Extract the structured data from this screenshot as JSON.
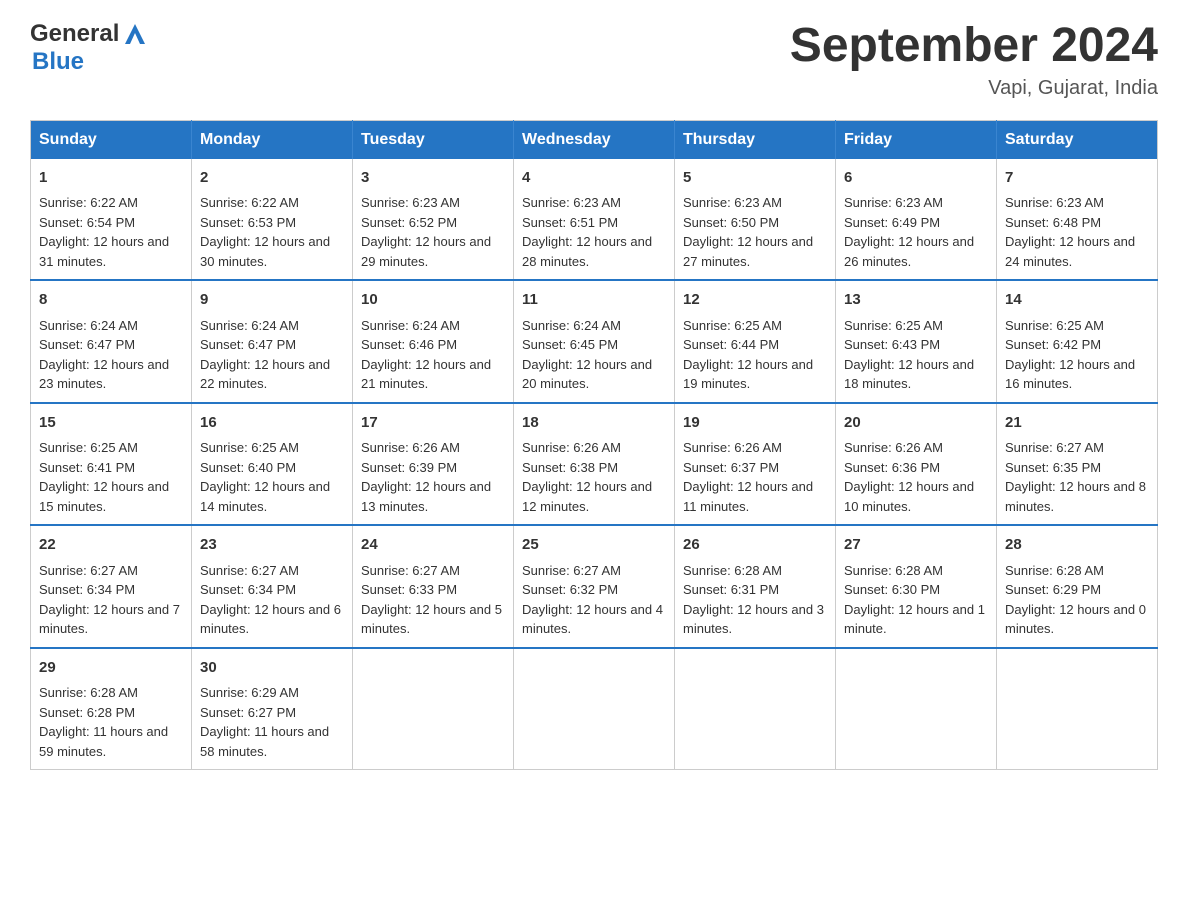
{
  "header": {
    "logo_general": "General",
    "logo_blue": "Blue",
    "title": "September 2024",
    "location": "Vapi, Gujarat, India"
  },
  "days_of_week": [
    "Sunday",
    "Monday",
    "Tuesday",
    "Wednesday",
    "Thursday",
    "Friday",
    "Saturday"
  ],
  "weeks": [
    [
      {
        "day": "1",
        "sunrise": "Sunrise: 6:22 AM",
        "sunset": "Sunset: 6:54 PM",
        "daylight": "Daylight: 12 hours and 31 minutes."
      },
      {
        "day": "2",
        "sunrise": "Sunrise: 6:22 AM",
        "sunset": "Sunset: 6:53 PM",
        "daylight": "Daylight: 12 hours and 30 minutes."
      },
      {
        "day": "3",
        "sunrise": "Sunrise: 6:23 AM",
        "sunset": "Sunset: 6:52 PM",
        "daylight": "Daylight: 12 hours and 29 minutes."
      },
      {
        "day": "4",
        "sunrise": "Sunrise: 6:23 AM",
        "sunset": "Sunset: 6:51 PM",
        "daylight": "Daylight: 12 hours and 28 minutes."
      },
      {
        "day": "5",
        "sunrise": "Sunrise: 6:23 AM",
        "sunset": "Sunset: 6:50 PM",
        "daylight": "Daylight: 12 hours and 27 minutes."
      },
      {
        "day": "6",
        "sunrise": "Sunrise: 6:23 AM",
        "sunset": "Sunset: 6:49 PM",
        "daylight": "Daylight: 12 hours and 26 minutes."
      },
      {
        "day": "7",
        "sunrise": "Sunrise: 6:23 AM",
        "sunset": "Sunset: 6:48 PM",
        "daylight": "Daylight: 12 hours and 24 minutes."
      }
    ],
    [
      {
        "day": "8",
        "sunrise": "Sunrise: 6:24 AM",
        "sunset": "Sunset: 6:47 PM",
        "daylight": "Daylight: 12 hours and 23 minutes."
      },
      {
        "day": "9",
        "sunrise": "Sunrise: 6:24 AM",
        "sunset": "Sunset: 6:47 PM",
        "daylight": "Daylight: 12 hours and 22 minutes."
      },
      {
        "day": "10",
        "sunrise": "Sunrise: 6:24 AM",
        "sunset": "Sunset: 6:46 PM",
        "daylight": "Daylight: 12 hours and 21 minutes."
      },
      {
        "day": "11",
        "sunrise": "Sunrise: 6:24 AM",
        "sunset": "Sunset: 6:45 PM",
        "daylight": "Daylight: 12 hours and 20 minutes."
      },
      {
        "day": "12",
        "sunrise": "Sunrise: 6:25 AM",
        "sunset": "Sunset: 6:44 PM",
        "daylight": "Daylight: 12 hours and 19 minutes."
      },
      {
        "day": "13",
        "sunrise": "Sunrise: 6:25 AM",
        "sunset": "Sunset: 6:43 PM",
        "daylight": "Daylight: 12 hours and 18 minutes."
      },
      {
        "day": "14",
        "sunrise": "Sunrise: 6:25 AM",
        "sunset": "Sunset: 6:42 PM",
        "daylight": "Daylight: 12 hours and 16 minutes."
      }
    ],
    [
      {
        "day": "15",
        "sunrise": "Sunrise: 6:25 AM",
        "sunset": "Sunset: 6:41 PM",
        "daylight": "Daylight: 12 hours and 15 minutes."
      },
      {
        "day": "16",
        "sunrise": "Sunrise: 6:25 AM",
        "sunset": "Sunset: 6:40 PM",
        "daylight": "Daylight: 12 hours and 14 minutes."
      },
      {
        "day": "17",
        "sunrise": "Sunrise: 6:26 AM",
        "sunset": "Sunset: 6:39 PM",
        "daylight": "Daylight: 12 hours and 13 minutes."
      },
      {
        "day": "18",
        "sunrise": "Sunrise: 6:26 AM",
        "sunset": "Sunset: 6:38 PM",
        "daylight": "Daylight: 12 hours and 12 minutes."
      },
      {
        "day": "19",
        "sunrise": "Sunrise: 6:26 AM",
        "sunset": "Sunset: 6:37 PM",
        "daylight": "Daylight: 12 hours and 11 minutes."
      },
      {
        "day": "20",
        "sunrise": "Sunrise: 6:26 AM",
        "sunset": "Sunset: 6:36 PM",
        "daylight": "Daylight: 12 hours and 10 minutes."
      },
      {
        "day": "21",
        "sunrise": "Sunrise: 6:27 AM",
        "sunset": "Sunset: 6:35 PM",
        "daylight": "Daylight: 12 hours and 8 minutes."
      }
    ],
    [
      {
        "day": "22",
        "sunrise": "Sunrise: 6:27 AM",
        "sunset": "Sunset: 6:34 PM",
        "daylight": "Daylight: 12 hours and 7 minutes."
      },
      {
        "day": "23",
        "sunrise": "Sunrise: 6:27 AM",
        "sunset": "Sunset: 6:34 PM",
        "daylight": "Daylight: 12 hours and 6 minutes."
      },
      {
        "day": "24",
        "sunrise": "Sunrise: 6:27 AM",
        "sunset": "Sunset: 6:33 PM",
        "daylight": "Daylight: 12 hours and 5 minutes."
      },
      {
        "day": "25",
        "sunrise": "Sunrise: 6:27 AM",
        "sunset": "Sunset: 6:32 PM",
        "daylight": "Daylight: 12 hours and 4 minutes."
      },
      {
        "day": "26",
        "sunrise": "Sunrise: 6:28 AM",
        "sunset": "Sunset: 6:31 PM",
        "daylight": "Daylight: 12 hours and 3 minutes."
      },
      {
        "day": "27",
        "sunrise": "Sunrise: 6:28 AM",
        "sunset": "Sunset: 6:30 PM",
        "daylight": "Daylight: 12 hours and 1 minute."
      },
      {
        "day": "28",
        "sunrise": "Sunrise: 6:28 AM",
        "sunset": "Sunset: 6:29 PM",
        "daylight": "Daylight: 12 hours and 0 minutes."
      }
    ],
    [
      {
        "day": "29",
        "sunrise": "Sunrise: 6:28 AM",
        "sunset": "Sunset: 6:28 PM",
        "daylight": "Daylight: 11 hours and 59 minutes."
      },
      {
        "day": "30",
        "sunrise": "Sunrise: 6:29 AM",
        "sunset": "Sunset: 6:27 PM",
        "daylight": "Daylight: 11 hours and 58 minutes."
      },
      null,
      null,
      null,
      null,
      null
    ]
  ]
}
